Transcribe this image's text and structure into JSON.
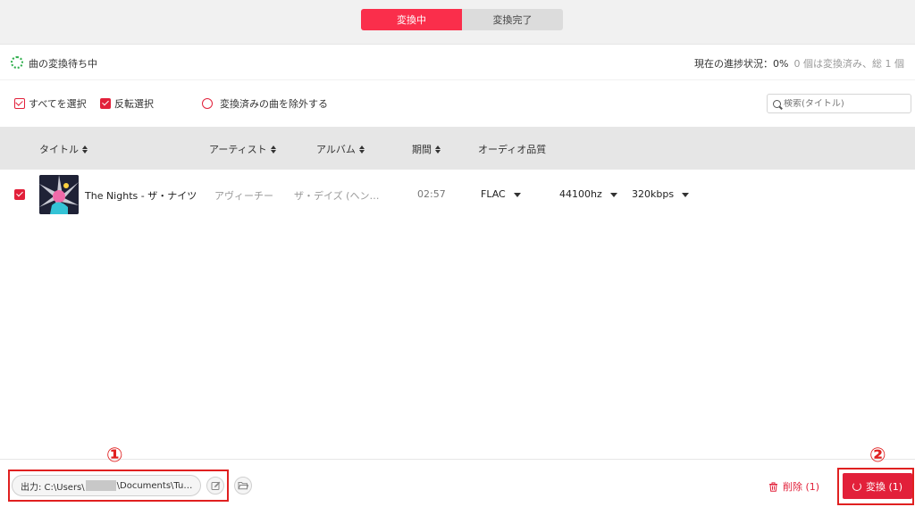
{
  "tabs": {
    "converting": "変換中",
    "converted": "変換完了"
  },
  "status": {
    "waiting": "曲の変換待ち中",
    "progress": "現在の進捗状況：0%",
    "summary": "0 個は変換済み、総 1 個"
  },
  "toolbar": {
    "select_all": "すべてを選択",
    "invert": "反転選択",
    "exclude": "変換済みの曲を除外する",
    "search_placeholder": "検索(タイトル)"
  },
  "columns": {
    "title": "タイトル",
    "artist": "アーティスト",
    "album": "アルバム",
    "duration": "期間",
    "quality": "オーディオ品質"
  },
  "rows": [
    {
      "title": "The Nights - ザ・ナイツ",
      "artist": "アヴィーチー",
      "album": "ザ・デイズ (ヘン…",
      "duration": "02:57",
      "format": "FLAC",
      "samplerate": "44100hz",
      "bitrate": "320kbps",
      "selected": true
    }
  ],
  "bottom": {
    "output_prefix": "出力: C:\\Users\\",
    "output_suffix": "\\Documents\\Tu…",
    "delete": "削除 (1)",
    "convert": "変換 (1)"
  },
  "annotations": {
    "marker1": "①",
    "marker2": "②"
  },
  "colors": {
    "accent": "#e2203a",
    "tab_active": "#fa2e4b",
    "annotation": "#e02020"
  },
  "icons": [
    "spinner-icon",
    "search-icon",
    "sort-icon",
    "dropdown-caret-icon",
    "edit-icon",
    "folder-icon",
    "trash-icon",
    "refresh-icon"
  ]
}
